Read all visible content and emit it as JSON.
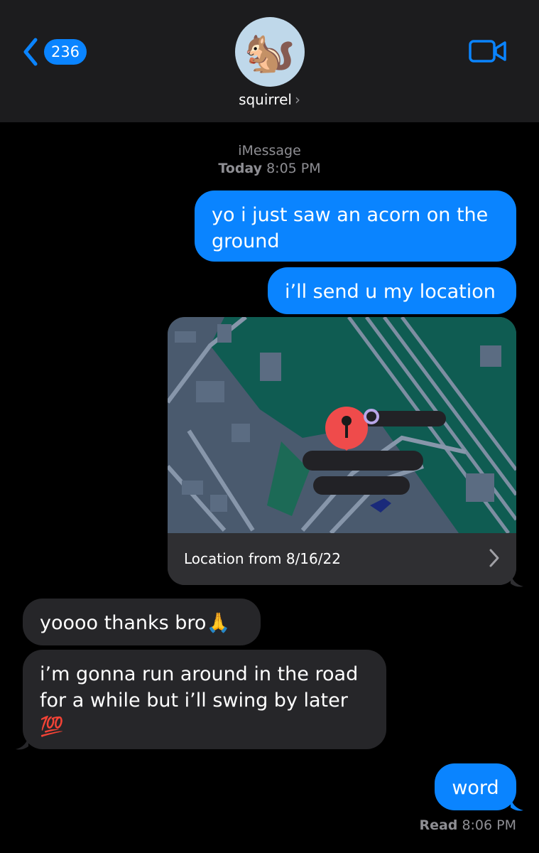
{
  "header": {
    "unread_count": "236",
    "avatar_emoji": "🐿️",
    "contact_name": "squirrel",
    "contact_chevron": "›"
  },
  "meta": {
    "service": "iMessage",
    "day": "Today",
    "time": "8:05 PM"
  },
  "messages": [
    {
      "from": "me",
      "text": "yo i just saw an acorn on the ground"
    },
    {
      "from": "me",
      "text": "i’ll send u my location"
    },
    {
      "from": "me",
      "type": "location",
      "text": "Location from 8/16/22"
    },
    {
      "from": "them",
      "text": "yoooo thanks bro🙏"
    },
    {
      "from": "them",
      "text": "i’m gonna run around in the road for a while but i’ll swing by later 💯"
    },
    {
      "from": "me",
      "text": "word"
    }
  ],
  "status": {
    "label": "Read",
    "time": "8:06 PM"
  },
  "colors": {
    "outgoing": "#0a84ff",
    "incoming": "#262629",
    "header_bg": "#1c1c1e",
    "map_water": "#0f5c52",
    "map_land": "#4a5a6e",
    "pin": "#ef4b4b"
  }
}
